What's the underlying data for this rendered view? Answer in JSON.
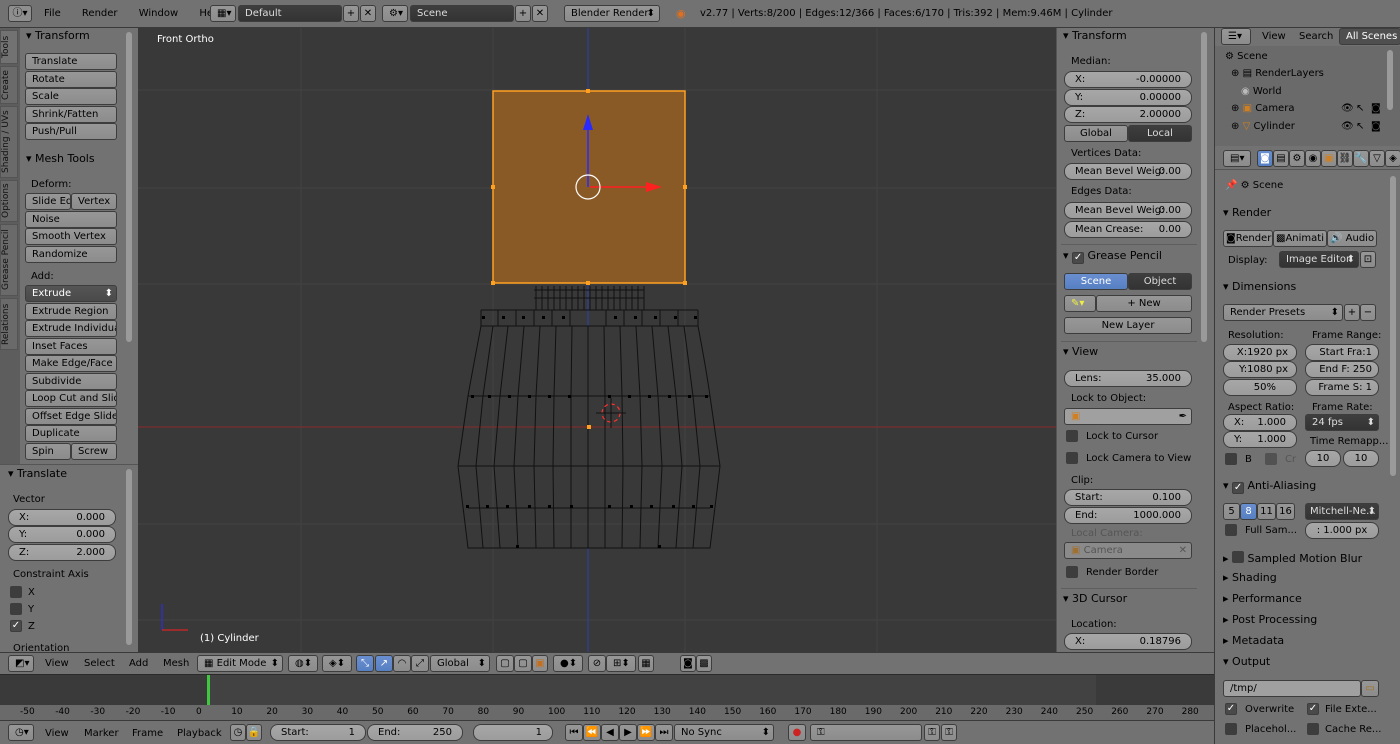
{
  "top_header": {
    "menu": [
      "File",
      "Render",
      "Window",
      "Help"
    ],
    "layout": "Default",
    "scene": "Scene",
    "engine": "Blender Render",
    "stats": "v2.77 | Verts:8/200 | Edges:12/366 | Faces:6/170 | Tris:392 | Mem:9.46M | Cylinder"
  },
  "tool_tabs": [
    "Tools",
    "Create",
    "Shading / UVs",
    "Options",
    "Grease Pencil",
    "Relations"
  ],
  "tools": {
    "transform_title": "Transform",
    "transform_buttons": [
      "Translate",
      "Rotate",
      "Scale",
      "Shrink/Fatten",
      "Push/Pull"
    ],
    "mesh_title": "Mesh Tools",
    "deform_label": "Deform:",
    "slide_edge": "Slide Ed",
    "vertex": "Vertex",
    "deform_buttons": [
      "Noise",
      "Smooth Vertex",
      "Randomize"
    ],
    "add_label": "Add:",
    "extrude": "Extrude",
    "add_buttons": [
      "Extrude Region",
      "Extrude Individual",
      "Inset Faces",
      "Make Edge/Face",
      "Subdivide",
      "Loop Cut and Slide",
      "Offset Edge Slide",
      "Duplicate"
    ],
    "spin": "Spin",
    "screw": "Screw"
  },
  "operator": {
    "title": "Translate",
    "vector_label": "Vector",
    "x": "X:",
    "x_val": "0.000",
    "y": "Y:",
    "y_val": "0.000",
    "z": "Z:",
    "z_val": "2.000",
    "constraint_label": "Constraint Axis",
    "axes": [
      "X",
      "Y",
      "Z"
    ],
    "orientation": "Orientation"
  },
  "viewport": {
    "view_name": "Front Ortho",
    "object_name": "(1) Cylinder"
  },
  "properties": {
    "transform_title": "Transform",
    "median": "Median:",
    "x": "X:",
    "x_val": "-0.00000",
    "y": "Y:",
    "y_val": "0.00000",
    "z": "Z:",
    "z_val": "2.00000",
    "global": "Global",
    "local": "Local",
    "vertices_data": "Vertices Data:",
    "mean_bevel_v": "Mean Bevel Weig:",
    "mean_bevel_v_val": "0.00",
    "edges_data": "Edges Data:",
    "mean_bevel_e": "Mean Bevel Weig:",
    "mean_bevel_e_val": "0.00",
    "mean_crease": "Mean Crease:",
    "mean_crease_val": "0.00",
    "grease_title": "Grease Pencil",
    "scene": "Scene",
    "object": "Object",
    "new": "New",
    "new_layer": "New Layer",
    "view_title": "View",
    "lens": "Lens:",
    "lens_val": "35.000",
    "lock_obj": "Lock to Object:",
    "lock_cursor": "Lock to Cursor",
    "lock_camera": "Lock Camera to View",
    "clip": "Clip:",
    "start": "Start:",
    "start_val": "0.100",
    "end": "End:",
    "end_val": "1000.000",
    "local_camera": "Local Camera:",
    "camera": "Camera",
    "render_border": "Render Border",
    "cursor_title": "3D Cursor",
    "location": "Location:",
    "cx": "X:",
    "cx_val": "0.18796"
  },
  "viewport_header": {
    "menu": [
      "View",
      "Select",
      "Add",
      "Mesh"
    ],
    "mode": "Edit Mode",
    "orientation": "Global"
  },
  "outliner": {
    "view": "View",
    "search": "Search",
    "all_scenes": "All Scenes",
    "items": [
      "Scene",
      "RenderLayers",
      "World",
      "Camera",
      "Cylinder"
    ]
  },
  "render_props": {
    "scene": "Scene",
    "render_title": "Render",
    "render_btn": "Render",
    "anim_btn": "Animati",
    "audio_btn": "Audio",
    "display": "Display:",
    "display_val": "Image Editor",
    "dimensions_title": "Dimensions",
    "presets": "Render Presets",
    "resolution": "Resolution:",
    "res_x": "X:1920 px",
    "res_y": "Y:1080 px",
    "res_pct": "50%",
    "frame_range": "Frame Range:",
    "start_frame": "Start Fra:1",
    "end_frame": "End F: 250",
    "frame_step": "Frame S: 1",
    "aspect": "Aspect Ratio:",
    "ax": "X:",
    "ax_val": "1.000",
    "ay": "Y:",
    "ay_val": "1.000",
    "frame_rate": "Frame Rate:",
    "fps": "24 fps",
    "time_remap": "Time Remapp...",
    "remap_a": "10",
    "remap_b": "10",
    "b": "B",
    "cr": "Cr",
    "aa_title": "Anti-Aliasing",
    "aa_samples": [
      "5",
      "8",
      "11",
      "16"
    ],
    "filter": "Mitchell-Ne...",
    "full_sample": "Full Sam...",
    "filter_size": ": 1.000 px",
    "motion_blur": "Sampled Motion Blur",
    "shading": "Shading",
    "performance": "Performance",
    "post": "Post Processing",
    "metadata": "Metadata",
    "output": "Output",
    "path": "/tmp/",
    "overwrite": "Overwrite",
    "file_ext": "File Exte...",
    "placeholders": "Placehol...",
    "cache": "Cache Re..."
  },
  "timeline": {
    "ticks": [
      "-50",
      "-40",
      "-30",
      "-20",
      "-10",
      "0",
      "10",
      "20",
      "30",
      "40",
      "50",
      "60",
      "70",
      "80",
      "90",
      "100",
      "110",
      "120",
      "130",
      "140",
      "150",
      "160",
      "170",
      "180",
      "190",
      "200",
      "210",
      "220",
      "230",
      "240",
      "250",
      "260",
      "270",
      "280"
    ],
    "menu": [
      "View",
      "Marker",
      "Frame",
      "Playback"
    ],
    "start": "Start:",
    "start_val": "1",
    "end": "End:",
    "end_val": "250",
    "current": "1",
    "sync": "No Sync"
  },
  "colors": {
    "selected_face": "#8a5a26",
    "selection_outline": "#ffa020",
    "z_axis": "#2020ff",
    "x_axis": "#ff2020",
    "active_button": "#5680c2"
  }
}
